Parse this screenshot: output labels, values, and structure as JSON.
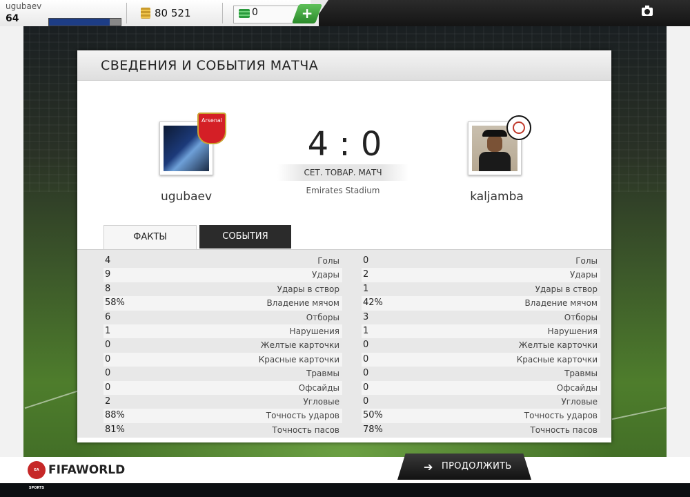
{
  "topbar": {
    "username": "ugubaev",
    "level": "64",
    "xp_fraction": 0.85,
    "coins": "80 521",
    "points": "0",
    "plus_label": "+",
    "icons": [
      "coins-icon",
      "fifa-points-icon",
      "plus-icon",
      "camera-icon"
    ]
  },
  "panel": {
    "title": "СВЕДЕНИЯ И СОБЫТИЯ МАТЧА",
    "score": "4 : 0",
    "match_type": "СЕТ. ТОВАР. МАТЧ",
    "stadium": "Emirates Stadium",
    "home": {
      "name": "ugubaev",
      "badge_text": "Arsenal"
    },
    "away": {
      "name": "kaljamba"
    },
    "tabs": {
      "facts": "ФАКТЫ",
      "events": "СОБЫТИЯ"
    }
  },
  "stats": {
    "labels": [
      "Голы",
      "Удары",
      "Удары в створ",
      "Владение мячом",
      "Отборы",
      "Нарушения",
      "Желтые карточки",
      "Красные карточки",
      "Травмы",
      "Офсайды",
      "Угловые",
      "Точность ударов",
      "Точность пасов"
    ],
    "home": [
      "4",
      "9",
      "8",
      "58%",
      "6",
      "1",
      "0",
      "0",
      "0",
      "0",
      "2",
      "88%",
      "81%"
    ],
    "away": [
      "0",
      "2",
      "1",
      "42%",
      "3",
      "1",
      "0",
      "0",
      "0",
      "0",
      "0",
      "50%",
      "78%"
    ]
  },
  "footer": {
    "logo_ea": "EA SPORTS",
    "logo_text": "FIFAWORLD",
    "continue_label": "ПРОДОЛЖИТЬ"
  },
  "colors": {
    "topbar_dark": "#141414",
    "xp_fill": "#1d3d86",
    "plus_green": "#2a8a2a",
    "arsenal_red": "#d41f26"
  }
}
